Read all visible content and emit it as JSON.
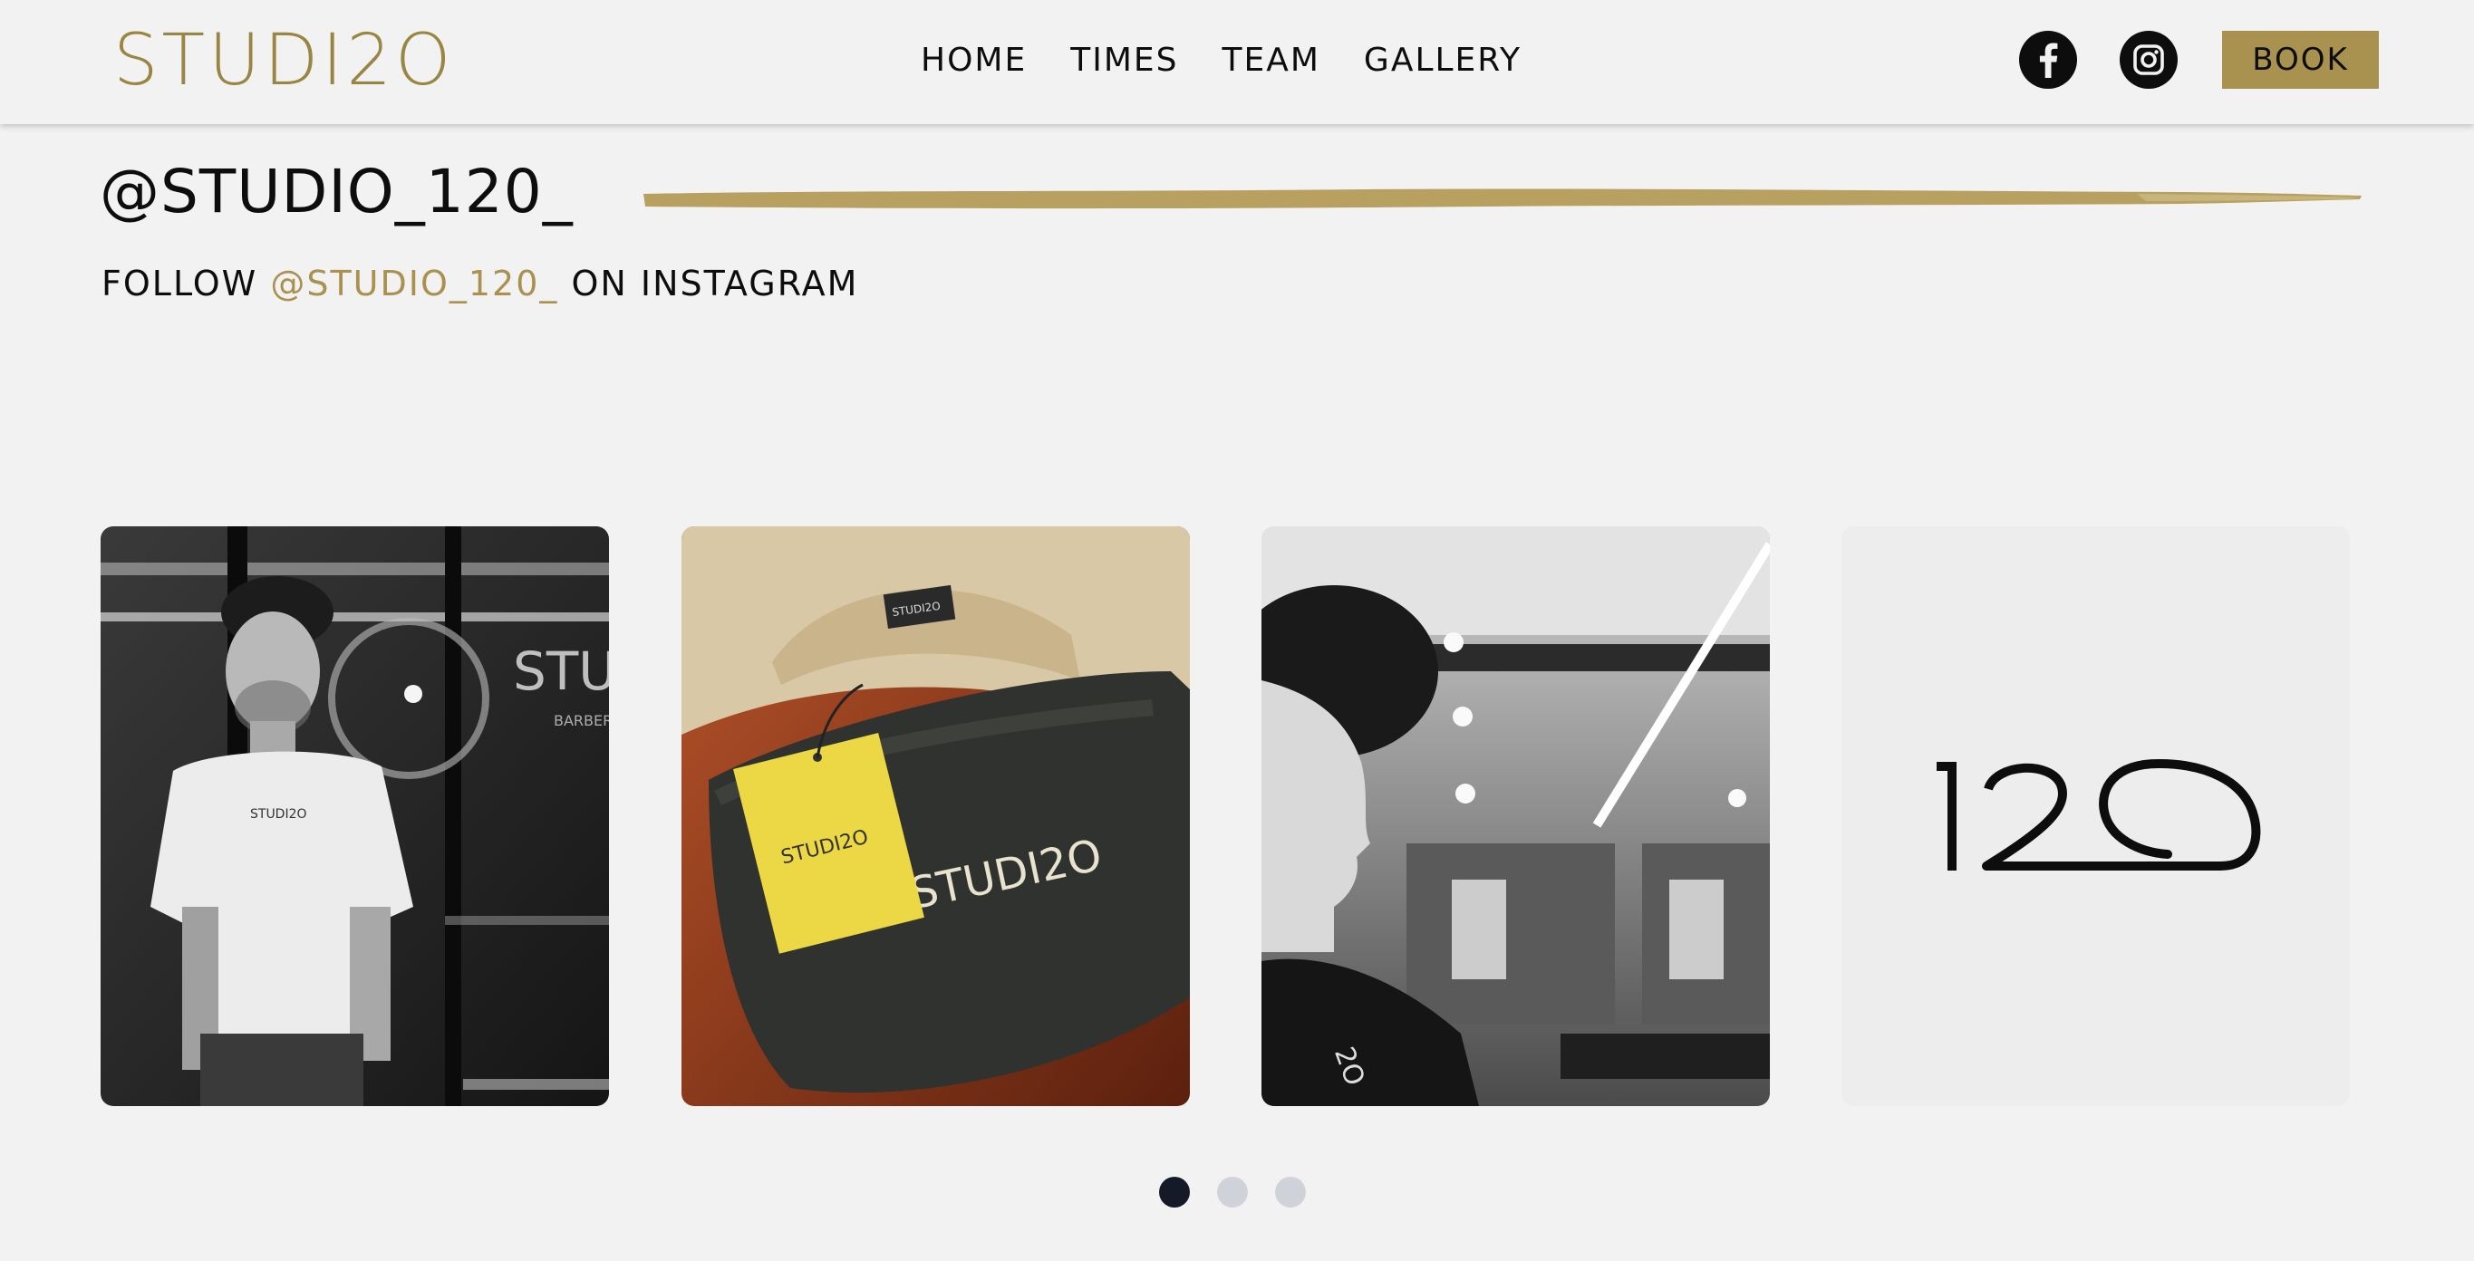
{
  "header": {
    "logo": "STUDI2O",
    "nav": [
      {
        "label": "HOME"
      },
      {
        "label": "TIMES"
      },
      {
        "label": "TEAM"
      },
      {
        "label": "GALLERY"
      }
    ],
    "social": [
      {
        "icon": "facebook-icon"
      },
      {
        "icon": "instagram-icon"
      }
    ],
    "book_label": "BOOK"
  },
  "instagram": {
    "title": "@STUDIO_120_",
    "follow_prefix": "FOLLOW",
    "follow_handle": "@STUDIO_120_",
    "follow_suffix": "ON INSTAGRAM"
  },
  "gallery": {
    "tiles": [
      {
        "description": "Barber in white STUDI2O t-shirt outside shop window",
        "shirt_text": "STUDI2O",
        "window_text": "STUD",
        "window_subtext": "BARBER"
      },
      {
        "description": "STUDI2O merchandise bag with yellow tag",
        "tag_text": "STUDI2O",
        "bag_text": "STUDI2O"
      },
      {
        "description": "Profile of client with curly hair inside barbershop",
        "cape_text": "2O"
      },
      {
        "description": "120 logo",
        "logo_text": "120"
      }
    ],
    "pagination": {
      "total": 3,
      "active": 0
    }
  },
  "colors": {
    "accent": "#a99250",
    "logo": "#9a8643",
    "background": "#f2f2f2",
    "dot_active": "#141a28",
    "dot_inactive": "#cfd3d9"
  }
}
